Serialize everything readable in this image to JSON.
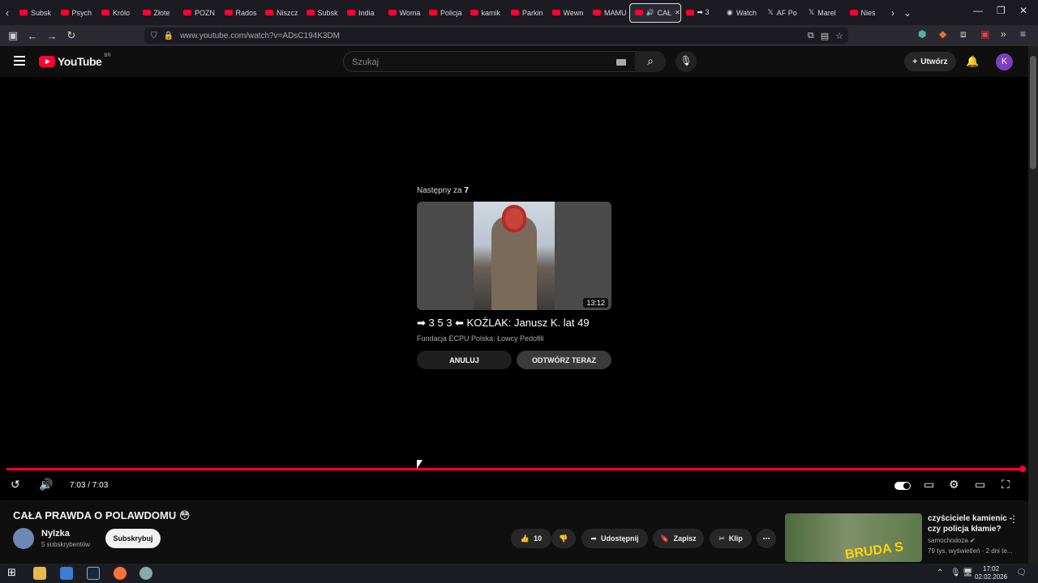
{
  "browser": {
    "tabs": [
      {
        "label": "Subsk",
        "icon": "youtube-icon"
      },
      {
        "label": "Psych",
        "icon": "youtube-icon"
      },
      {
        "label": "Królo",
        "icon": "youtube-icon"
      },
      {
        "label": "Złote",
        "icon": "youtube-icon"
      },
      {
        "label": "POZN",
        "icon": "youtube-icon"
      },
      {
        "label": "Rados",
        "icon": "youtube-icon"
      },
      {
        "label": "Niszcz",
        "icon": "youtube-icon"
      },
      {
        "label": "Subsk",
        "icon": "youtube-icon"
      },
      {
        "label": "India",
        "icon": "youtube-icon"
      },
      {
        "label": "Woma",
        "icon": "youtube-icon"
      },
      {
        "label": "Policja",
        "icon": "youtube-icon"
      },
      {
        "label": "kamik",
        "icon": "youtube-icon"
      },
      {
        "label": "Parkin",
        "icon": "youtube-icon"
      },
      {
        "label": "Wewn",
        "icon": "youtube-icon"
      },
      {
        "label": "MAMU",
        "icon": "youtube-icon"
      },
      {
        "label": "CAŁ",
        "icon": "youtube-icon",
        "active": true
      },
      {
        "label": "➡ 3",
        "icon": "youtube-icon"
      },
      {
        "label": "Watch",
        "icon": "watch-icon"
      },
      {
        "label": "AF Po",
        "icon": "x-icon"
      },
      {
        "label": "Marel",
        "icon": "x-icon"
      },
      {
        "label": "Nies",
        "icon": "youtube-icon"
      }
    ],
    "url": "www.youtube.com/watch?v=ADsC194K3DM"
  },
  "header": {
    "logo_text": "YouTube",
    "country_code": "BR",
    "search_placeholder": "Szukaj",
    "create_label": "Utwórz",
    "avatar_letter": "K"
  },
  "endscreen": {
    "next_prefix": "Następny za",
    "countdown": "7",
    "duration": "13:12",
    "title": "➡ 3 5 3 ⬅ KOŹLAK: Janusz K. lat 49",
    "channel": "Fundacja ECPU Polska: Łowcy Pedofili",
    "cancel_label": "ANULUJ",
    "play_label": "ODTWÓRZ TERAZ"
  },
  "player": {
    "time": "7:03 / 7:03",
    "progress": 1.0
  },
  "video": {
    "title": "CAŁA PRAWDA O POLAWDOMU 😳",
    "channel_name": "Nylzka",
    "subscribers": "5 subskrybentów",
    "subscribe_label": "Subskrybuj",
    "likes": "10",
    "share_label": "Udostępnij",
    "save_label": "Zapisz",
    "clip_label": "Klip"
  },
  "recommendation": {
    "title": "czyściciele kamienic - czy policja kłamie?",
    "channel": "samochodoza",
    "meta": "79 tys. wyświetleń · 2 dni te...",
    "thumb_text": "BRUDA S"
  },
  "taskbar": {
    "time": "17:02",
    "date": "02.02.2026"
  }
}
